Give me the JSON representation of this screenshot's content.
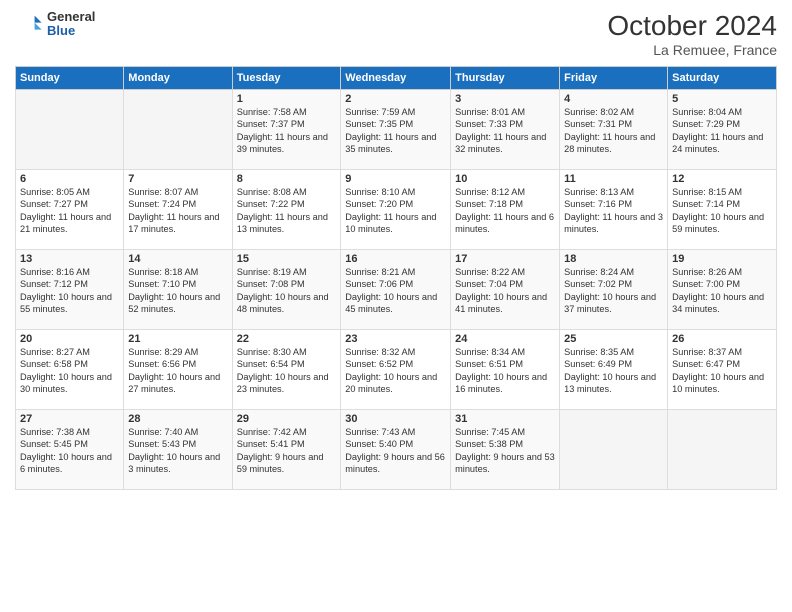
{
  "header": {
    "logo": {
      "general": "General",
      "blue": "Blue"
    },
    "title": "October 2024",
    "subtitle": "La Remuee, France"
  },
  "days_of_week": [
    "Sunday",
    "Monday",
    "Tuesday",
    "Wednesday",
    "Thursday",
    "Friday",
    "Saturday"
  ],
  "weeks": [
    [
      {
        "day": "",
        "content": ""
      },
      {
        "day": "",
        "content": ""
      },
      {
        "day": "1",
        "content": "Sunrise: 7:58 AM\nSunset: 7:37 PM\nDaylight: 11 hours and 39 minutes."
      },
      {
        "day": "2",
        "content": "Sunrise: 7:59 AM\nSunset: 7:35 PM\nDaylight: 11 hours and 35 minutes."
      },
      {
        "day": "3",
        "content": "Sunrise: 8:01 AM\nSunset: 7:33 PM\nDaylight: 11 hours and 32 minutes."
      },
      {
        "day": "4",
        "content": "Sunrise: 8:02 AM\nSunset: 7:31 PM\nDaylight: 11 hours and 28 minutes."
      },
      {
        "day": "5",
        "content": "Sunrise: 8:04 AM\nSunset: 7:29 PM\nDaylight: 11 hours and 24 minutes."
      }
    ],
    [
      {
        "day": "6",
        "content": "Sunrise: 8:05 AM\nSunset: 7:27 PM\nDaylight: 11 hours and 21 minutes."
      },
      {
        "day": "7",
        "content": "Sunrise: 8:07 AM\nSunset: 7:24 PM\nDaylight: 11 hours and 17 minutes."
      },
      {
        "day": "8",
        "content": "Sunrise: 8:08 AM\nSunset: 7:22 PM\nDaylight: 11 hours and 13 minutes."
      },
      {
        "day": "9",
        "content": "Sunrise: 8:10 AM\nSunset: 7:20 PM\nDaylight: 11 hours and 10 minutes."
      },
      {
        "day": "10",
        "content": "Sunrise: 8:12 AM\nSunset: 7:18 PM\nDaylight: 11 hours and 6 minutes."
      },
      {
        "day": "11",
        "content": "Sunrise: 8:13 AM\nSunset: 7:16 PM\nDaylight: 11 hours and 3 minutes."
      },
      {
        "day": "12",
        "content": "Sunrise: 8:15 AM\nSunset: 7:14 PM\nDaylight: 10 hours and 59 minutes."
      }
    ],
    [
      {
        "day": "13",
        "content": "Sunrise: 8:16 AM\nSunset: 7:12 PM\nDaylight: 10 hours and 55 minutes."
      },
      {
        "day": "14",
        "content": "Sunrise: 8:18 AM\nSunset: 7:10 PM\nDaylight: 10 hours and 52 minutes."
      },
      {
        "day": "15",
        "content": "Sunrise: 8:19 AM\nSunset: 7:08 PM\nDaylight: 10 hours and 48 minutes."
      },
      {
        "day": "16",
        "content": "Sunrise: 8:21 AM\nSunset: 7:06 PM\nDaylight: 10 hours and 45 minutes."
      },
      {
        "day": "17",
        "content": "Sunrise: 8:22 AM\nSunset: 7:04 PM\nDaylight: 10 hours and 41 minutes."
      },
      {
        "day": "18",
        "content": "Sunrise: 8:24 AM\nSunset: 7:02 PM\nDaylight: 10 hours and 37 minutes."
      },
      {
        "day": "19",
        "content": "Sunrise: 8:26 AM\nSunset: 7:00 PM\nDaylight: 10 hours and 34 minutes."
      }
    ],
    [
      {
        "day": "20",
        "content": "Sunrise: 8:27 AM\nSunset: 6:58 PM\nDaylight: 10 hours and 30 minutes."
      },
      {
        "day": "21",
        "content": "Sunrise: 8:29 AM\nSunset: 6:56 PM\nDaylight: 10 hours and 27 minutes."
      },
      {
        "day": "22",
        "content": "Sunrise: 8:30 AM\nSunset: 6:54 PM\nDaylight: 10 hours and 23 minutes."
      },
      {
        "day": "23",
        "content": "Sunrise: 8:32 AM\nSunset: 6:52 PM\nDaylight: 10 hours and 20 minutes."
      },
      {
        "day": "24",
        "content": "Sunrise: 8:34 AM\nSunset: 6:51 PM\nDaylight: 10 hours and 16 minutes."
      },
      {
        "day": "25",
        "content": "Sunrise: 8:35 AM\nSunset: 6:49 PM\nDaylight: 10 hours and 13 minutes."
      },
      {
        "day": "26",
        "content": "Sunrise: 8:37 AM\nSunset: 6:47 PM\nDaylight: 10 hours and 10 minutes."
      }
    ],
    [
      {
        "day": "27",
        "content": "Sunrise: 7:38 AM\nSunset: 5:45 PM\nDaylight: 10 hours and 6 minutes."
      },
      {
        "day": "28",
        "content": "Sunrise: 7:40 AM\nSunset: 5:43 PM\nDaylight: 10 hours and 3 minutes."
      },
      {
        "day": "29",
        "content": "Sunrise: 7:42 AM\nSunset: 5:41 PM\nDaylight: 9 hours and 59 minutes."
      },
      {
        "day": "30",
        "content": "Sunrise: 7:43 AM\nSunset: 5:40 PM\nDaylight: 9 hours and 56 minutes."
      },
      {
        "day": "31",
        "content": "Sunrise: 7:45 AM\nSunset: 5:38 PM\nDaylight: 9 hours and 53 minutes."
      },
      {
        "day": "",
        "content": ""
      },
      {
        "day": "",
        "content": ""
      }
    ]
  ]
}
